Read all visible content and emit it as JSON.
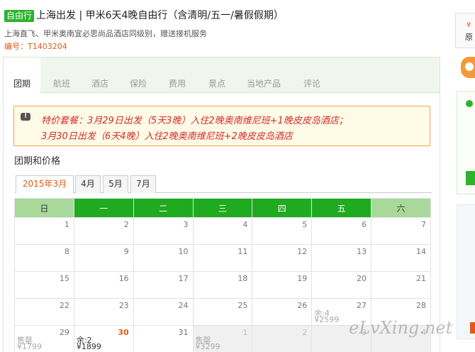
{
  "header": {
    "tag": "自由行",
    "title": "上海出发 | 甲米6天4晚自由行（含清明/五一/暑假假期）",
    "subtitle": "上海直飞、甲米奥南宜必思尚品酒店同级别，赠送接机服务",
    "code": "编号：T1403204"
  },
  "right_edge": {
    "price_symbol": "¥",
    "text": "原"
  },
  "tabs": [
    "团期",
    "航班",
    "酒店",
    "保险",
    "费用",
    "景点",
    "当地产品",
    "评论"
  ],
  "alert": {
    "line1": "特价套餐：3月29日出发（5天3晚）入住2晚奥南维尼班+1晚皮皮岛酒店；",
    "line2": "3月30日出发（6天4晚）入住2晚奥南维尼班+2晚皮皮岛酒店"
  },
  "section_title": "团期和价格",
  "month_tabs": [
    "2015年3月",
    "4月",
    "5月",
    "7月"
  ],
  "calendar": {
    "weekdays": [
      "日",
      "一",
      "二",
      "三",
      "四",
      "五",
      "六"
    ],
    "weeks": [
      [
        {
          "d": "1"
        },
        {
          "d": "2"
        },
        {
          "d": "3"
        },
        {
          "d": "4"
        },
        {
          "d": "5"
        },
        {
          "d": "6"
        },
        {
          "d": "7"
        }
      ],
      [
        {
          "d": "8"
        },
        {
          "d": "9"
        },
        {
          "d": "10"
        },
        {
          "d": "11"
        },
        {
          "d": "12"
        },
        {
          "d": "13"
        },
        {
          "d": "14"
        }
      ],
      [
        {
          "d": "15"
        },
        {
          "d": "16"
        },
        {
          "d": "17"
        },
        {
          "d": "18"
        },
        {
          "d": "19"
        },
        {
          "d": "20"
        },
        {
          "d": "21"
        }
      ],
      [
        {
          "d": "22"
        },
        {
          "d": "23"
        },
        {
          "d": "24"
        },
        {
          "d": "25"
        },
        {
          "d": "26"
        },
        {
          "d": "27",
          "label": "余:4",
          "price": "¥2599",
          "muted": true
        },
        {
          "d": "28"
        }
      ],
      [
        {
          "d": "29",
          "label": "售罄",
          "price": "¥1799",
          "muted": true
        },
        {
          "d": "30",
          "label": "余:2",
          "price": "¥1899",
          "highlight": true
        },
        {
          "d": "31"
        },
        {
          "d": "1",
          "label": "售罄",
          "price": "¥3299",
          "other": true
        },
        {
          "d": "2",
          "other": true
        },
        {
          "d": "3",
          "other": true
        },
        {
          "d": "4",
          "other": true
        }
      ]
    ]
  },
  "watermark": "eLvXing.net"
}
